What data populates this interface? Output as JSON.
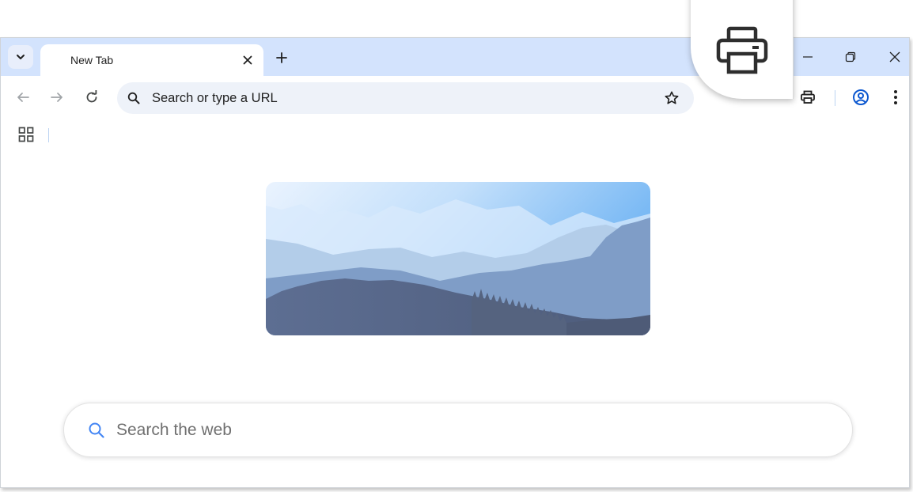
{
  "tabs": [
    {
      "title": "New Tab"
    }
  ],
  "omnibox": {
    "placeholder": "Search or type a URL"
  },
  "ntp": {
    "search_placeholder": "Search the web"
  },
  "colors": {
    "tabstrip_bg": "#d3e3fd",
    "omnibox_bg": "#eef2f9",
    "accent": "#0b57d0",
    "icon": "#444746"
  },
  "icons": {
    "tab_search": "chevron-down-icon",
    "tab_close": "close-icon",
    "new_tab": "plus-icon",
    "minimize": "minimize-icon",
    "restore": "restore-icon",
    "close_window": "close-icon",
    "back": "arrow-left-icon",
    "forward": "arrow-right-icon",
    "reload": "reload-icon",
    "omni_search": "search-icon",
    "bookmark": "star-icon",
    "print": "printer-icon",
    "profile": "account-circle-icon",
    "menu": "kebab-menu-icon",
    "apps": "apps-grid-icon",
    "magnified": "printer-icon"
  }
}
